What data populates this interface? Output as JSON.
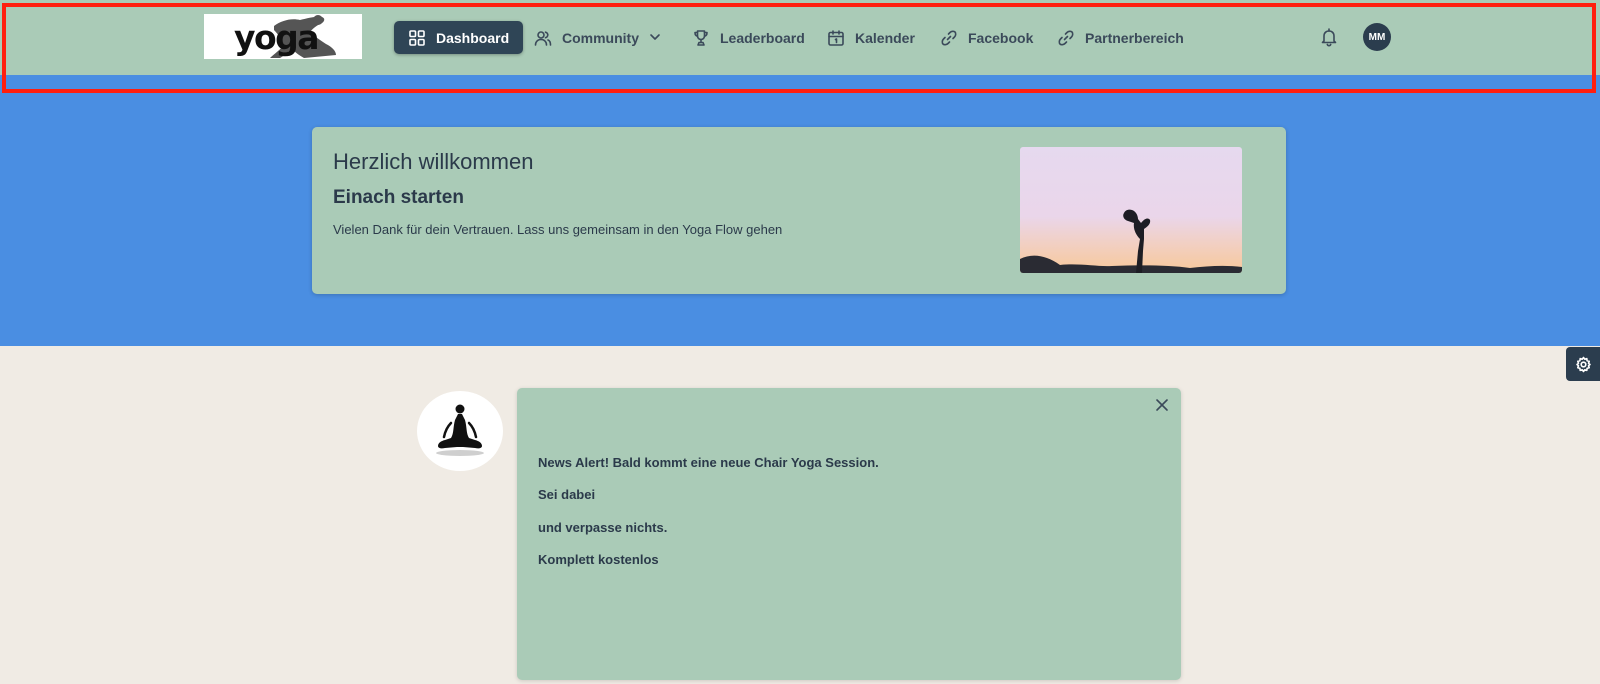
{
  "colors": {
    "nav_bg": "#aacbb7",
    "band_bg": "#4a8ee2",
    "page_bg": "#f0ebe4",
    "card_bg": "#aacbb7",
    "accent_dark": "#2f4556",
    "highlight": "#ff1f0f"
  },
  "header": {
    "logo_text": "yoga",
    "nav": [
      {
        "label": "Dashboard",
        "icon": "grid-icon",
        "active": true
      },
      {
        "label": "Community",
        "icon": "users-icon",
        "has_dropdown": true
      },
      {
        "label": "Leaderboard",
        "icon": "trophy-icon"
      },
      {
        "label": "Kalender",
        "icon": "calendar-icon"
      },
      {
        "label": "Facebook",
        "icon": "link-icon"
      },
      {
        "label": "Partnerbereich",
        "icon": "link-icon"
      }
    ],
    "notifications_icon": "bell-icon",
    "avatar_initials": "MM"
  },
  "welcome": {
    "title": "Herzlich willkommen",
    "subtitle": "Einach starten",
    "text": "Vielen Dank für dein Vertrauen. Lass uns gemeinsam in den Yoga Flow gehen"
  },
  "settings_icon": "gear-icon",
  "news": {
    "lines": [
      "News Alert! Bald kommt eine neue Chair Yoga Session.",
      "Sei dabei",
      "und verpasse nichts.",
      "Komplett kostenlos"
    ],
    "close_icon": "close-icon"
  }
}
